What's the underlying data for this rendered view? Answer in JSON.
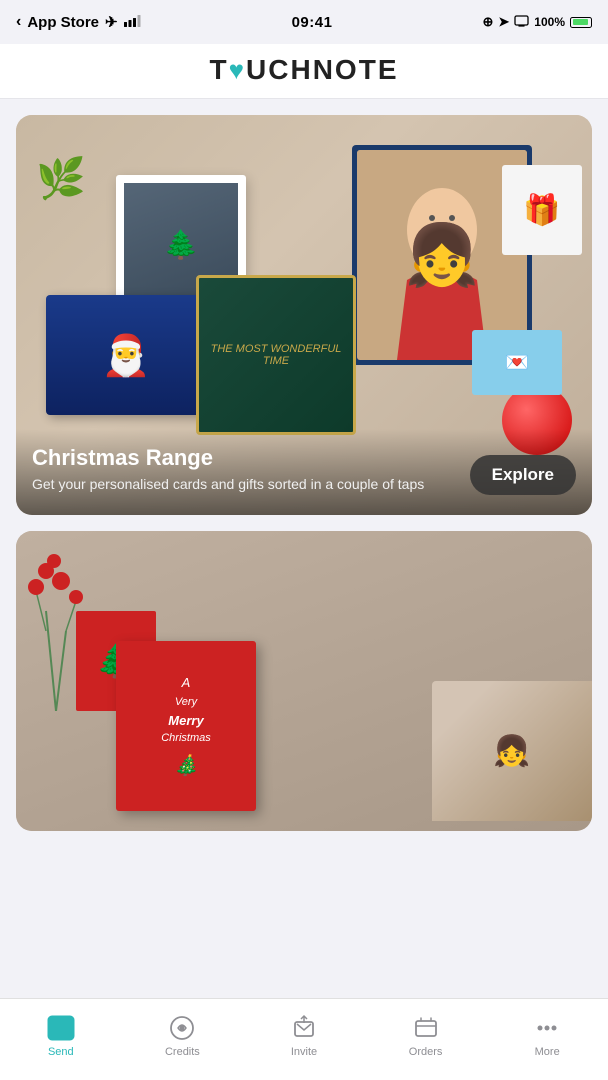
{
  "statusBar": {
    "carrier": "App Store",
    "time": "09:41",
    "batteryPercent": "100%"
  },
  "header": {
    "logoText": "T♥UCHNOTE"
  },
  "cards": [
    {
      "id": "christmas-range",
      "title": "Christmas Range",
      "subtitle": "Get your personalised cards and gifts sorted in a couple of taps",
      "ctaLabel": "Explore"
    },
    {
      "id": "christmas-cards",
      "title": "",
      "subtitle": "",
      "ctaLabel": ""
    }
  ],
  "tabBar": {
    "items": [
      {
        "id": "send",
        "label": "Send",
        "active": true
      },
      {
        "id": "credits",
        "label": "Credits",
        "active": false
      },
      {
        "id": "invite",
        "label": "Invite",
        "active": false
      },
      {
        "id": "orders",
        "label": "Orders",
        "active": false
      },
      {
        "id": "more",
        "label": "More",
        "active": false
      }
    ]
  }
}
